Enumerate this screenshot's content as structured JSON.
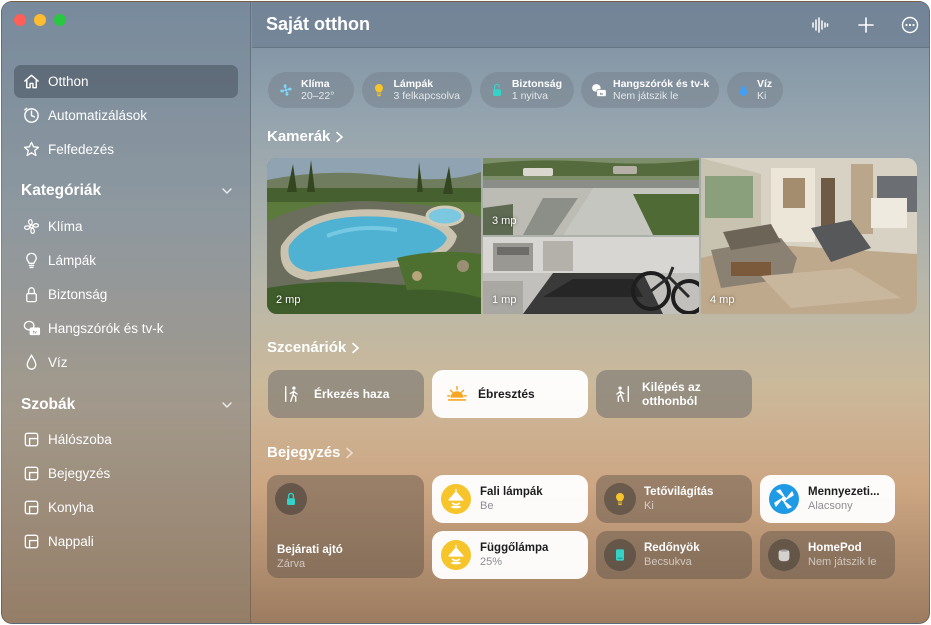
{
  "app": {
    "title": "Saját otthon"
  },
  "colors": {
    "accent_yellow": "#f6c42b",
    "lock_teal": "#34d3c8",
    "fan_blue": "#1f9be6",
    "blue_drop": "#3aa1ff"
  },
  "sidebar": {
    "top_items": [
      {
        "label": "Otthon",
        "icon": "house-icon",
        "active": true
      },
      {
        "label": "Automatizálások",
        "icon": "clock-check-icon"
      },
      {
        "label": "Felfedezés",
        "icon": "star-icon"
      }
    ],
    "categories_title": "Kategóriák",
    "categories": [
      {
        "label": "Klíma",
        "icon": "fan-icon"
      },
      {
        "label": "Lámpák",
        "icon": "bulb-icon"
      },
      {
        "label": "Biztonság",
        "icon": "lock-icon"
      },
      {
        "label": "Hangszórók és tv-k",
        "icon": "speaker-tv-icon"
      },
      {
        "label": "Víz",
        "icon": "drop-icon"
      }
    ],
    "rooms_title": "Szobák",
    "rooms": [
      {
        "label": "Hálószoba",
        "icon": "room-icon"
      },
      {
        "label": "Bejegyzés",
        "icon": "room-icon"
      },
      {
        "label": "Konyha",
        "icon": "room-icon"
      },
      {
        "label": "Nappali",
        "icon": "room-icon"
      }
    ]
  },
  "toolbar": {
    "icons": [
      "waveform-icon",
      "plus-icon",
      "ellipsis-circle-icon"
    ]
  },
  "status_pills": [
    {
      "name": "Klíma",
      "status": "20–22°",
      "icon": "fan-icon"
    },
    {
      "name": "Lámpák",
      "status": "3 felkapcsolva",
      "icon": "bulb-icon"
    },
    {
      "name": "Biztonság",
      "status": "1 nyitva",
      "icon": "lock-icon"
    },
    {
      "name": "Hangszórók és tv-k",
      "status": "Nem játszik le",
      "icon": "speaker-tv-icon"
    },
    {
      "name": "Víz",
      "status": "Ki",
      "icon": "drop-icon"
    }
  ],
  "cameras": {
    "title": "Kamerák",
    "feeds": [
      {
        "label": "2 mp",
        "scene": "pool"
      },
      {
        "label": "3 mp",
        "scene": "driveway"
      },
      {
        "label": "1 mp",
        "scene": "garage"
      },
      {
        "label": "4 mp",
        "scene": "living-room"
      }
    ]
  },
  "scenes": {
    "title": "Szcenáriók",
    "items": [
      {
        "label": "Érkezés haza",
        "icon": "person-arrive-icon",
        "active": false
      },
      {
        "label": "Ébresztés",
        "icon": "sunrise-icon",
        "active": true
      },
      {
        "label": "Kilépés az otthonból",
        "line1": "Kilépés az",
        "line2": "otthonból",
        "icon": "person-leave-icon",
        "active": false
      }
    ]
  },
  "entry": {
    "title": "Bejegyzés",
    "front_door": {
      "name": "Bejárati ajtó",
      "status": "Zárva",
      "icon": "lock-icon"
    },
    "accessories": [
      {
        "name": "Fali lámpák",
        "status": "Be",
        "icon": "pendant-lamp-icon",
        "on": true
      },
      {
        "name": "Tetővilágítás",
        "status": "Ki",
        "icon": "bulb-icon",
        "on": false
      },
      {
        "name": "Mennyezeti...",
        "status": "Alacsony",
        "icon": "ceiling-fan-icon",
        "on": true
      },
      {
        "name": "Függőlámpa",
        "status": "25%",
        "icon": "pendant-lamp-icon",
        "on": true
      },
      {
        "name": "Redőnyök",
        "status": "Becsukva",
        "icon": "blinds-icon",
        "on": false
      },
      {
        "name": "HomePod",
        "status": "Nem játszik le",
        "icon": "homepod-icon",
        "on": false
      }
    ]
  }
}
